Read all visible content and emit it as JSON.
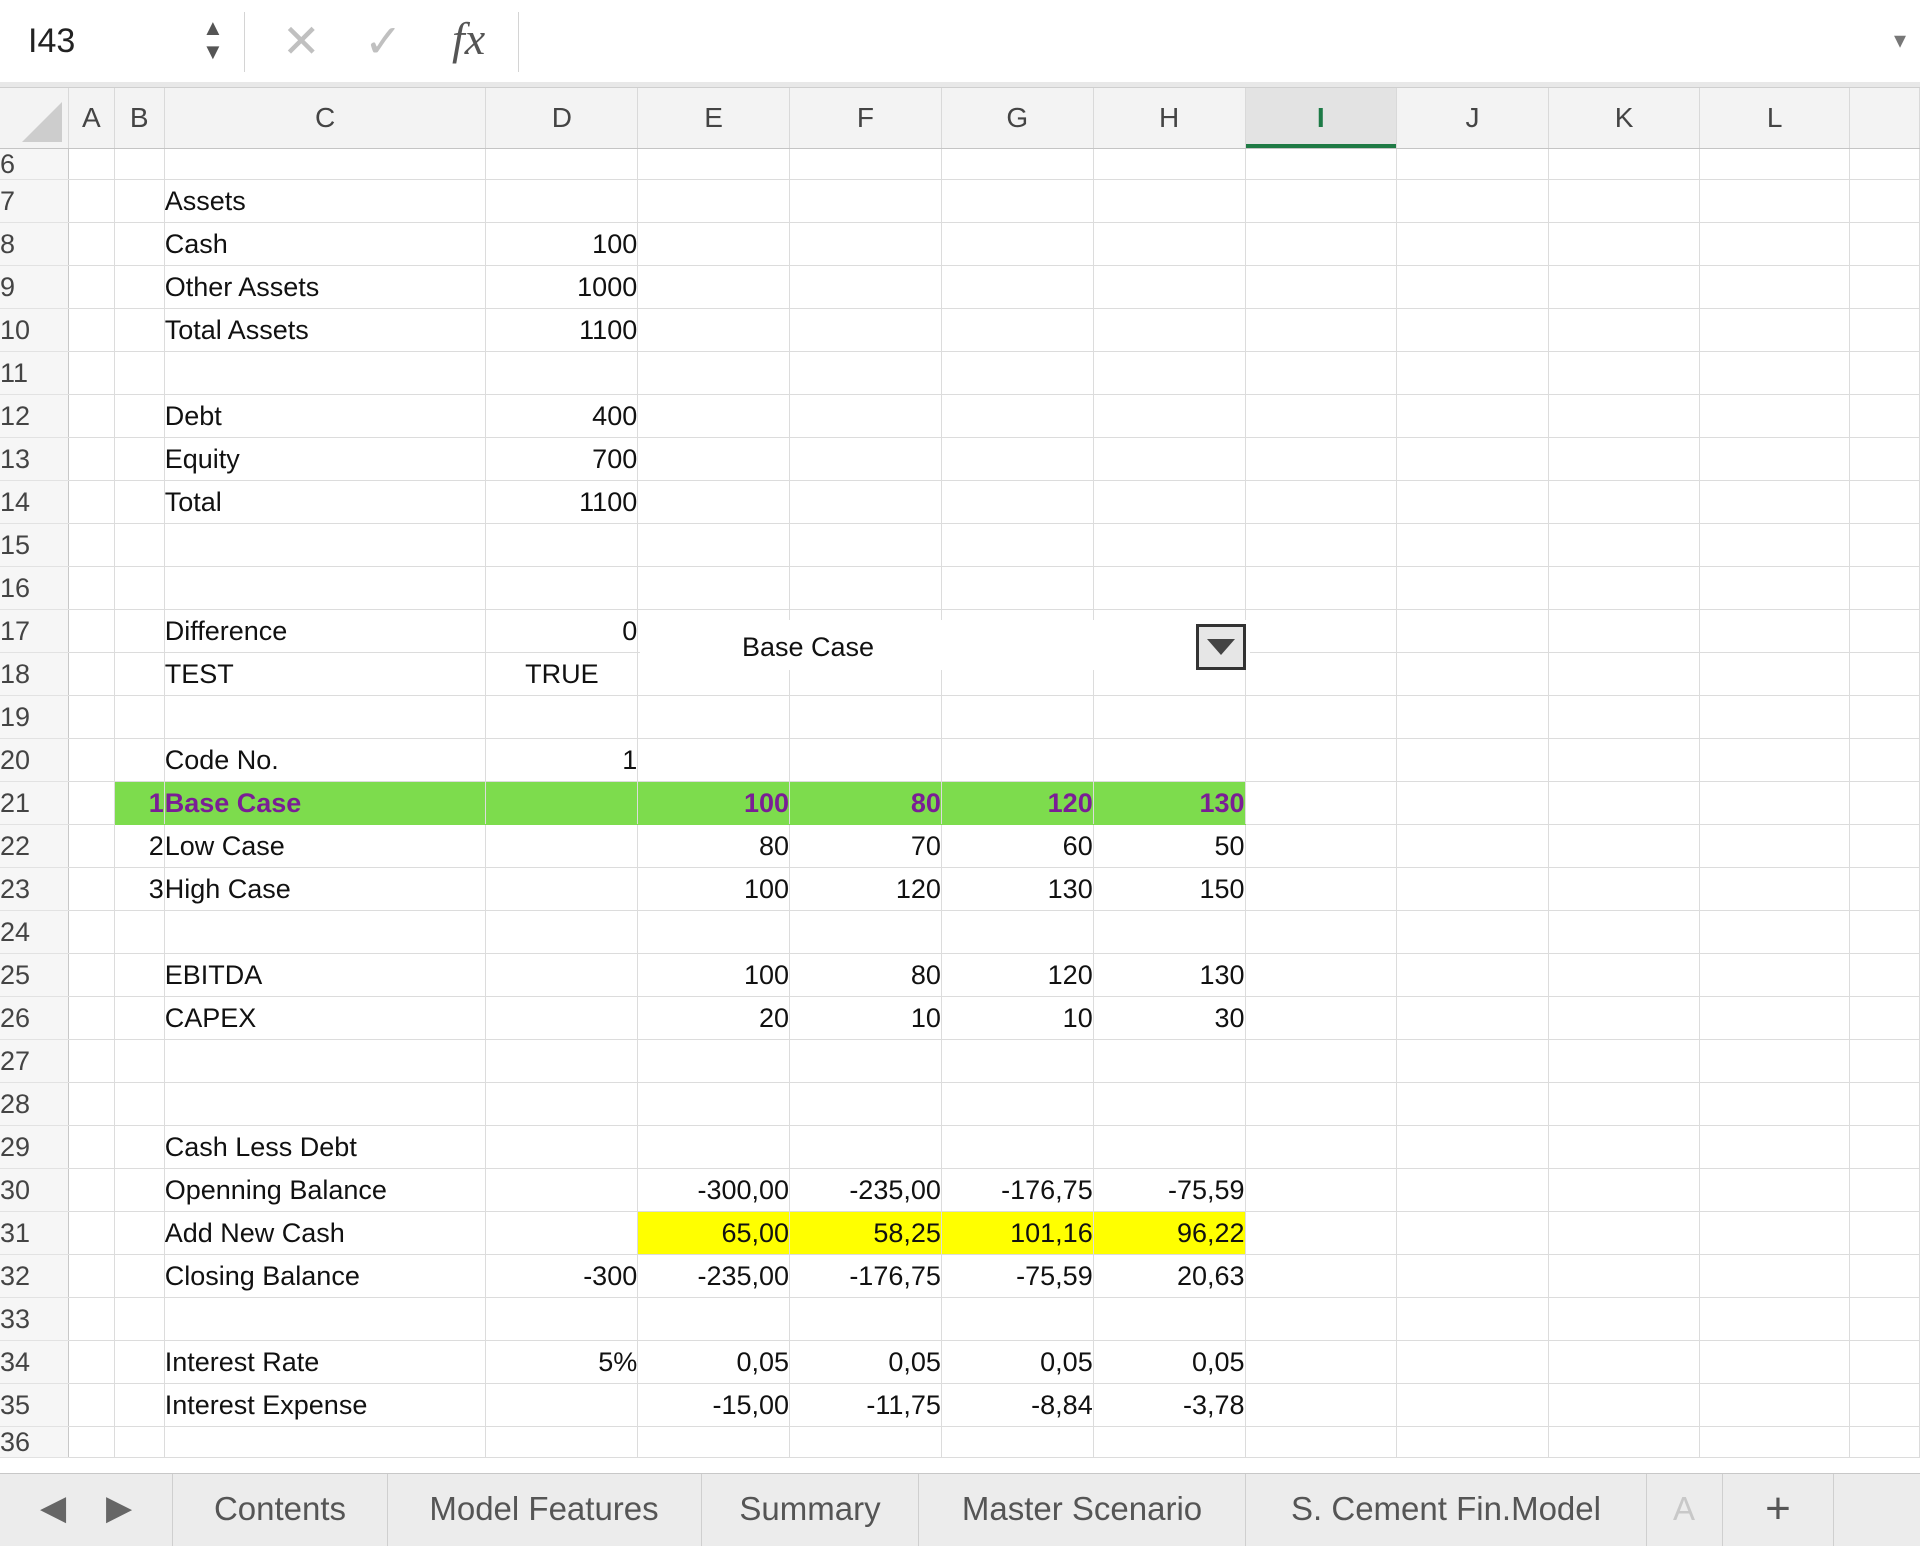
{
  "formula_bar": {
    "name_box": "I43",
    "formula": "",
    "cancel_glyph": "✕",
    "enter_glyph": "✓",
    "fx_glyph": "fx",
    "expand_glyph": "▾",
    "spin_glyph": "▲\n▼"
  },
  "columns": [
    "A",
    "B",
    "C",
    "D",
    "E",
    "F",
    "G",
    "H",
    "I",
    "J",
    "K",
    "L"
  ],
  "selected_column": "I",
  "rows": [
    {
      "n": "6",
      "B": "",
      "C": "",
      "D": "",
      "E": "",
      "F": "",
      "G": "",
      "H": ""
    },
    {
      "n": "7",
      "B": "",
      "C": "Assets",
      "D": "",
      "E": "",
      "F": "",
      "G": "",
      "H": ""
    },
    {
      "n": "8",
      "B": "",
      "C": "Cash",
      "D": "100",
      "E": "",
      "F": "",
      "G": "",
      "H": ""
    },
    {
      "n": "9",
      "B": "",
      "C": "Other Assets",
      "D": "1000",
      "E": "",
      "F": "",
      "G": "",
      "H": ""
    },
    {
      "n": "10",
      "B": "",
      "C": "Total Assets",
      "D": "1100",
      "E": "",
      "F": "",
      "G": "",
      "H": ""
    },
    {
      "n": "11",
      "B": "",
      "C": "",
      "D": "",
      "E": "",
      "F": "",
      "G": "",
      "H": ""
    },
    {
      "n": "12",
      "B": "",
      "C": "Debt",
      "D": "400",
      "E": "",
      "F": "",
      "G": "",
      "H": ""
    },
    {
      "n": "13",
      "B": "",
      "C": "Equity",
      "D": "700",
      "E": "",
      "F": "",
      "G": "",
      "H": ""
    },
    {
      "n": "14",
      "B": "",
      "C": "Total",
      "D": "1100",
      "E": "",
      "F": "",
      "G": "",
      "H": ""
    },
    {
      "n": "15",
      "B": "",
      "C": "",
      "D": "",
      "E": "",
      "F": "",
      "G": "",
      "H": ""
    },
    {
      "n": "16",
      "B": "",
      "C": "",
      "D": "",
      "E": "",
      "F": "",
      "G": "",
      "H": ""
    },
    {
      "n": "17",
      "B": "",
      "C": "Difference",
      "D": "0",
      "E": "",
      "F": "",
      "G": "",
      "H": ""
    },
    {
      "n": "18",
      "B": "",
      "C": "TEST",
      "D": "TRUE",
      "E": "",
      "F": "",
      "G": "",
      "H": ""
    },
    {
      "n": "19",
      "B": "",
      "C": "",
      "D": "",
      "E": "",
      "F": "",
      "G": "",
      "H": ""
    },
    {
      "n": "20",
      "B": "",
      "C": "Code No.",
      "D": "1",
      "E": "",
      "F": "",
      "G": "",
      "H": ""
    },
    {
      "n": "21",
      "B": "1",
      "C": "Base Case",
      "D": "",
      "E": "100",
      "F": "80",
      "G": "120",
      "H": "130"
    },
    {
      "n": "22",
      "B": "2",
      "C": "Low Case",
      "D": "",
      "E": "80",
      "F": "70",
      "G": "60",
      "H": "50"
    },
    {
      "n": "23",
      "B": "3",
      "C": "High Case",
      "D": "",
      "E": "100",
      "F": "120",
      "G": "130",
      "H": "150"
    },
    {
      "n": "24",
      "B": "",
      "C": "",
      "D": "",
      "E": "",
      "F": "",
      "G": "",
      "H": ""
    },
    {
      "n": "25",
      "B": "",
      "C": "EBITDA",
      "D": "",
      "E": "100",
      "F": "80",
      "G": "120",
      "H": "130"
    },
    {
      "n": "26",
      "B": "",
      "C": "CAPEX",
      "D": "",
      "E": "20",
      "F": "10",
      "G": "10",
      "H": "30"
    },
    {
      "n": "27",
      "B": "",
      "C": "",
      "D": "",
      "E": "",
      "F": "",
      "G": "",
      "H": ""
    },
    {
      "n": "28",
      "B": "",
      "C": "",
      "D": "",
      "E": "",
      "F": "",
      "G": "",
      "H": ""
    },
    {
      "n": "29",
      "B": "",
      "C": "Cash Less Debt",
      "D": "",
      "E": "",
      "F": "",
      "G": "",
      "H": ""
    },
    {
      "n": "30",
      "B": "",
      "C": "Openning Balance",
      "D": "",
      "E": "-300,00",
      "F": "-235,00",
      "G": "-176,75",
      "H": "-75,59"
    },
    {
      "n": "31",
      "B": "",
      "C": "Add New Cash",
      "D": "",
      "E": "65,00",
      "F": "58,25",
      "G": "101,16",
      "H": "96,22"
    },
    {
      "n": "32",
      "B": "",
      "C": "Closing Balance",
      "D": "-300",
      "E": "-235,00",
      "F": "-176,75",
      "G": "-75,59",
      "H": "20,63"
    },
    {
      "n": "33",
      "B": "",
      "C": "",
      "D": "",
      "E": "",
      "F": "",
      "G": "",
      "H": ""
    },
    {
      "n": "34",
      "B": "",
      "C": "Interest Rate",
      "D": "5%",
      "E": "0,05",
      "F": "0,05",
      "G": "0,05",
      "H": "0,05"
    },
    {
      "n": "35",
      "B": "",
      "C": "Interest Expense",
      "D": "",
      "E": "-15,00",
      "F": "-11,75",
      "G": "-8,84",
      "H": "-3,78"
    },
    {
      "n": "36",
      "B": "",
      "C": "",
      "D": "",
      "E": "",
      "F": "",
      "G": "",
      "H": ""
    }
  ],
  "dropdown": {
    "value": "Base Case"
  },
  "highlight_colors": {
    "scenario_row": "#7ddc4d",
    "scenario_text": "#7a1e95",
    "new_cash": "#ffff00",
    "selected_column": "#1f7a45"
  },
  "tabs": {
    "prev": "◀",
    "next": "▶",
    "items": [
      "Contents",
      "Model Features",
      "Summary",
      "Master Scenario",
      "S. Cement Fin.Model"
    ],
    "overflow": "A",
    "add": "+"
  }
}
